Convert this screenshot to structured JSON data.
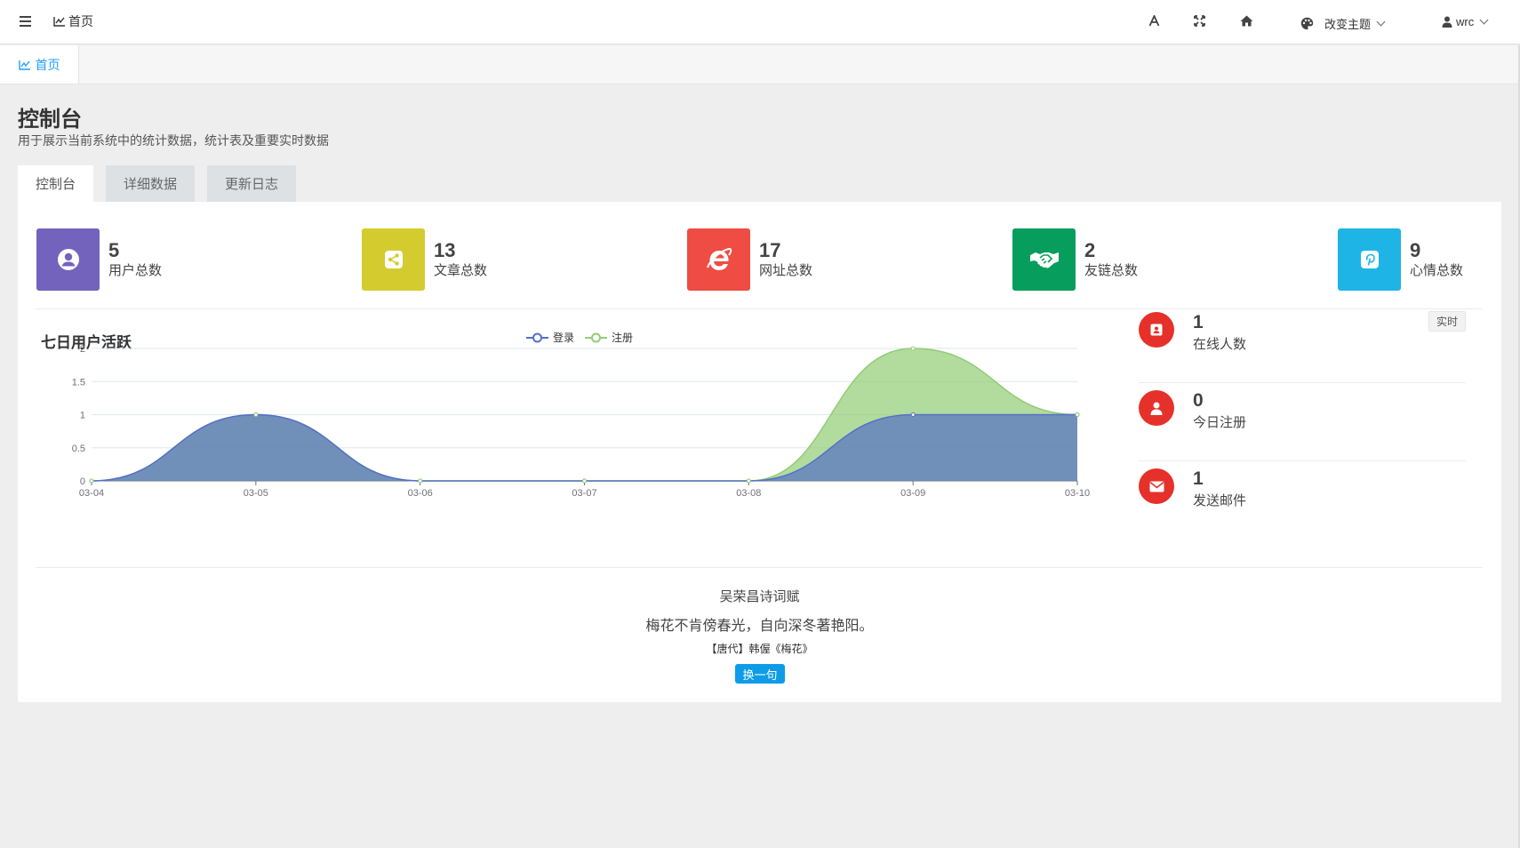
{
  "header": {
    "home_label": "首页",
    "theme_label": "改变主题",
    "user_name": "wrc",
    "icons": [
      "menu-icon",
      "chart-line-icon",
      "font-icon",
      "fullscreen-icon",
      "home-icon",
      "palette-icon",
      "user-icon"
    ]
  },
  "page_tabs": [
    {
      "label": "首页"
    }
  ],
  "page": {
    "title": "控制台",
    "description": "用于展示当前系统中的统计数据，统计表及重要实时数据"
  },
  "sub_tabs": [
    {
      "label": "控制台",
      "active": true
    },
    {
      "label": "详细数据",
      "active": false
    },
    {
      "label": "更新日志",
      "active": false
    }
  ],
  "stats": [
    {
      "value": "5",
      "label": "用户总数",
      "color": "#7363bd",
      "icon": "user-circle-icon"
    },
    {
      "value": "13",
      "label": "文章总数",
      "color": "#d4cc2e",
      "icon": "share-icon"
    },
    {
      "value": "17",
      "label": "网址总数",
      "color": "#ef4c43",
      "icon": "internet-explorer-icon"
    },
    {
      "value": "2",
      "label": "友链总数",
      "color": "#079d5c",
      "icon": "handshake-icon"
    },
    {
      "value": "9",
      "label": "心情总数",
      "color": "#1eb5e6",
      "icon": "pinterest-icon"
    }
  ],
  "chart_data": {
    "type": "area",
    "title": "七日用户活跃",
    "categories": [
      "03-04",
      "03-05",
      "03-06",
      "03-07",
      "03-08",
      "03-09",
      "03-10"
    ],
    "series": [
      {
        "name": "登录",
        "values": [
          0,
          1,
          0,
          0,
          0,
          1,
          1
        ],
        "color": "#5470c6"
      },
      {
        "name": "注册",
        "values": [
          0,
          1,
          0,
          0,
          0,
          2,
          1
        ],
        "color": "#91cc75"
      }
    ],
    "yticks": [
      "0",
      "0.5",
      "1",
      "1.5",
      "2"
    ],
    "ylim": [
      0,
      2
    ],
    "stacked": false,
    "smooth": true,
    "legend": "top-center",
    "grid": true
  },
  "realtime": [
    {
      "value": "1",
      "label": "在线人数",
      "badge": "实时",
      "icon": "id-card-icon"
    },
    {
      "value": "0",
      "label": "今日注册",
      "icon": "user-icon"
    },
    {
      "value": "1",
      "label": "发送邮件",
      "icon": "envelope-icon"
    }
  ],
  "poem": {
    "title": "吴荣昌诗词赋",
    "line": "梅花不肯傍春光，自向深冬著艳阳。",
    "source": "【唐代】韩偓《梅花》",
    "button": "换一句"
  }
}
